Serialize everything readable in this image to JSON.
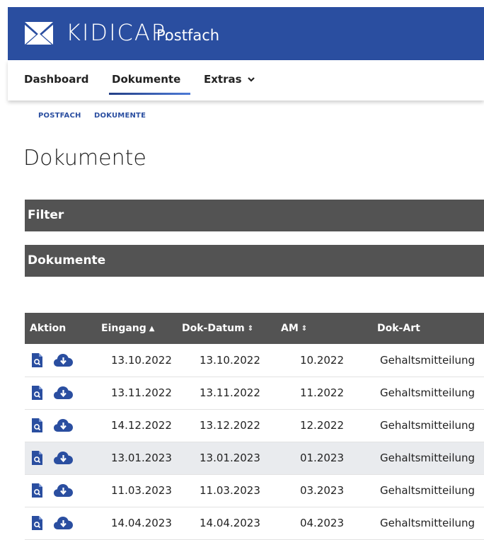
{
  "header": {
    "brand": "KIDICAP.",
    "subtitle": "Postfach",
    "colors": {
      "brand_bar": "#2a4ea0",
      "panel": "#535353",
      "highlight_row": "#e9ebee"
    }
  },
  "nav": {
    "items": [
      {
        "label": "Dashboard"
      },
      {
        "label": "Dokumente",
        "active": true
      },
      {
        "label": "Extras",
        "icon": "chevron-down-icon"
      }
    ]
  },
  "breadcrumb": [
    "POSTFACH",
    "DOKUMENTE"
  ],
  "page": {
    "title": "Dokumente"
  },
  "panels": {
    "filter": "Filter",
    "documents": "Dokumente"
  },
  "table": {
    "columns": [
      {
        "label": "Aktion"
      },
      {
        "label": "Eingang",
        "sort": "▲"
      },
      {
        "label": "Dok-Datum",
        "sort": "⇕"
      },
      {
        "label": "AM",
        "sort": "⇕"
      },
      {
        "label": "Dok-Art"
      }
    ],
    "row_icons": [
      "document-search-icon",
      "cloud-download-icon"
    ],
    "rows": [
      {
        "eingang": "13.10.2022",
        "dok_datum": "13.10.2022",
        "am": "10.2022",
        "dok_art": "Gehaltsmitteilung"
      },
      {
        "eingang": "13.11.2022",
        "dok_datum": "13.11.2022",
        "am": "11.2022",
        "dok_art": "Gehaltsmitteilung"
      },
      {
        "eingang": "14.12.2022",
        "dok_datum": "13.12.2022",
        "am": "12.2022",
        "dok_art": "Gehaltsmitteilung"
      },
      {
        "eingang": "13.01.2023",
        "dok_datum": "13.01.2023",
        "am": "01.2023",
        "dok_art": "Gehaltsmitteilung",
        "highlighted": true
      },
      {
        "eingang": "11.03.2023",
        "dok_datum": "11.03.2023",
        "am": "03.2023",
        "dok_art": "Gehaltsmitteilung"
      },
      {
        "eingang": "14.04.2023",
        "dok_datum": "14.04.2023",
        "am": "04.2023",
        "dok_art": "Gehaltsmitteilung"
      }
    ]
  }
}
